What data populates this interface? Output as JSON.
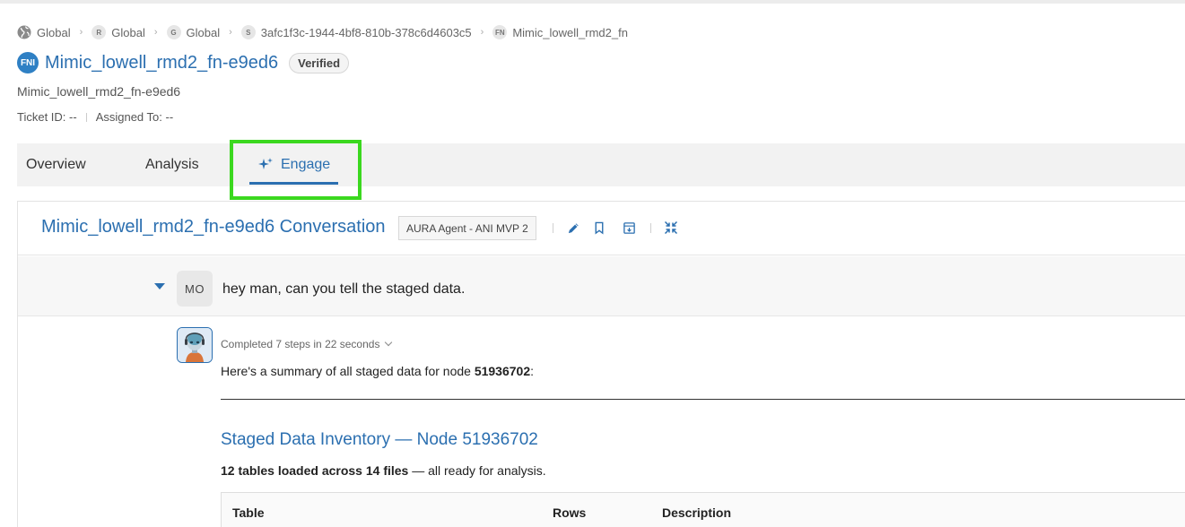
{
  "breadcrumb": [
    {
      "badge": "",
      "label": "Global"
    },
    {
      "badge": "R",
      "label": "Global"
    },
    {
      "badge": "G",
      "label": "Global"
    },
    {
      "badge": "S",
      "label": "3afc1f3c-1944-4bf8-810b-378c6d4603c5"
    },
    {
      "badge": "FN",
      "label": "Mimic_lowell_rmd2_fn"
    }
  ],
  "header": {
    "badge": "FNI",
    "title": "Mimic_lowell_rmd2_fn-e9ed6",
    "status": "Verified",
    "subtitle": "Mimic_lowell_rmd2_fn-e9ed6",
    "ticket": "Ticket ID: --",
    "assigned": "Assigned To: --"
  },
  "tabs": {
    "overview": "Overview",
    "analysis": "Analysis",
    "engage": "Engage",
    "active": "engage"
  },
  "conversation": {
    "title": "Mimic_lowell_rmd2_fn-e9ed6 Conversation",
    "agent": "AURA Agent - ANI MVP 2",
    "user_initials": "MO",
    "user_message": "hey man, can you tell the staged data.",
    "steps": "Completed 7 steps in 22 seconds",
    "summary_prefix": "Here's a summary of all staged data for node ",
    "summary_node": "51936702",
    "summary_suffix": ":",
    "inventory_title": "Staged Data Inventory — Node 51936702",
    "inventory_bold": "12 tables loaded across 14 files",
    "inventory_rest": " — all ready for analysis.",
    "table_headers": [
      "Table",
      "Rows",
      "Description"
    ]
  },
  "colors": {
    "accent": "#2b6fb0",
    "highlight": "#3bd81f"
  }
}
